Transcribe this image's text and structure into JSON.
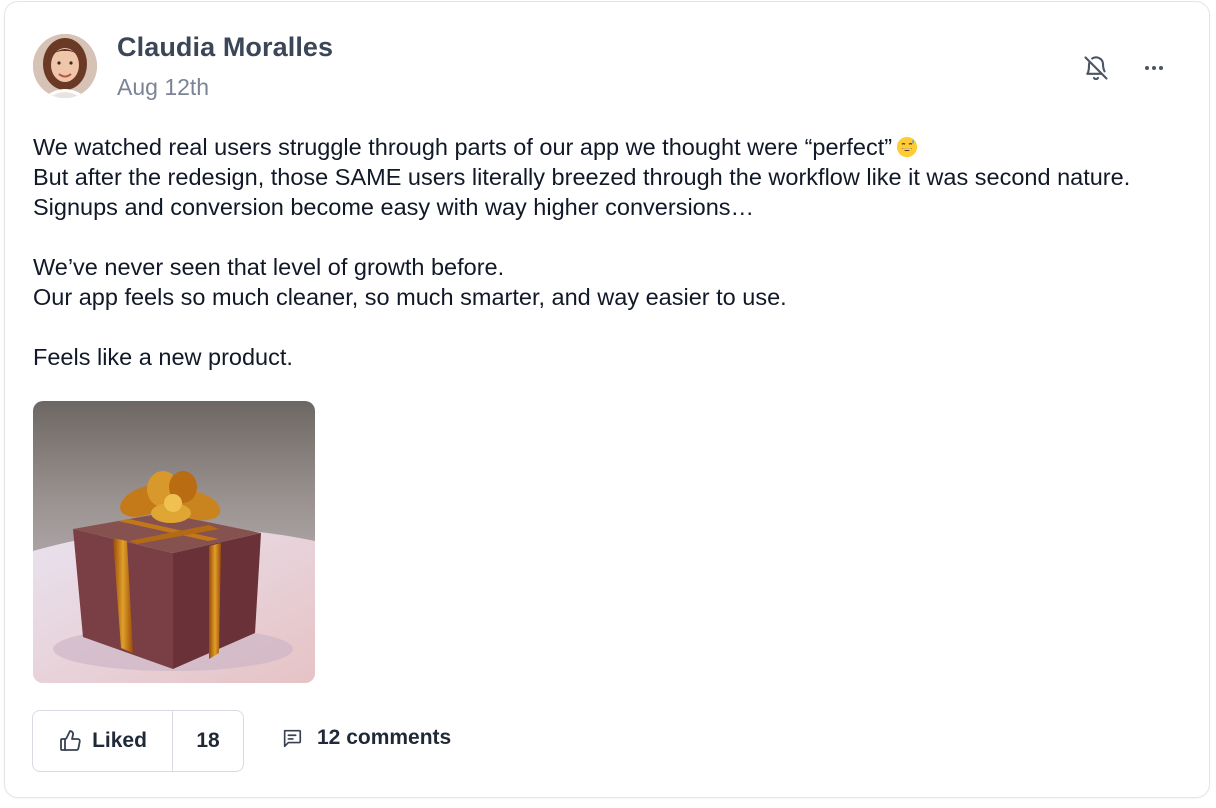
{
  "post": {
    "author": "Claudia Moralles",
    "date": "Aug 12th",
    "paragraphs": [
      {
        "line1": "We watched real users struggle through parts of our app we thought were “perfect”",
        "line1_emoji": "grinning-sweat-emoji",
        "line2": "But after the redesign, those SAME users literally breezed through the workflow like it was second nature. Signups and conversion become easy with way higher conversions…"
      },
      {
        "line1": "We’ve never seen that level of growth before.",
        "line2": "Our app feels so much cleaner, so much smarter, and way easier to use."
      },
      {
        "line1": "Feels like a new product."
      }
    ],
    "image_icon": "gift-box-image"
  },
  "actions": {
    "like_label": "Liked",
    "like_count": "18",
    "comments_label": "12 comments"
  },
  "icons": {
    "mute": "bell-off-icon",
    "more": "more-horizontal-icon",
    "like": "thumbs-up-icon",
    "comment": "comment-icon"
  },
  "colors": {
    "author": "#3b4656",
    "muted": "#7b8494",
    "border": "#d8dbe1"
  }
}
